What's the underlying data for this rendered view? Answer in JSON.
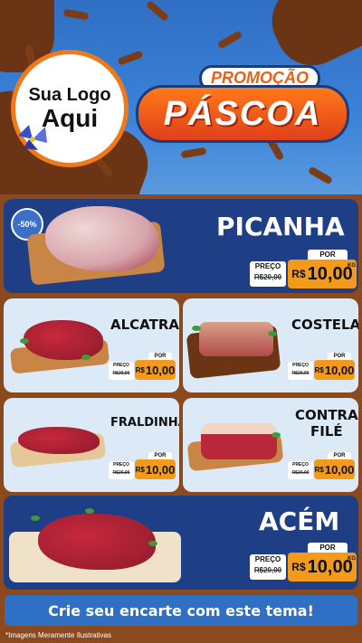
{
  "header": {
    "logo_line1": "Sua Logo",
    "logo_line2": "Aqui",
    "promo_line1": "PROMOÇÃO",
    "promo_line2": "PÁSCOA"
  },
  "products": [
    {
      "name": "PICANHA",
      "discount": "-50%",
      "price_label": "PREÇO",
      "old_price": "R$20,00",
      "new_label": "POR",
      "currency": "R$",
      "new_price": "10,00",
      "unit": "KG"
    },
    {
      "name": "ALCATRA",
      "price_label": "PREÇO",
      "old_price": "R$20,00",
      "new_label": "POR",
      "currency": "R$",
      "new_price": "10,00"
    },
    {
      "name": "COSTELA",
      "price_label": "PREÇO",
      "old_price": "R$20,00",
      "new_label": "POR",
      "currency": "R$",
      "new_price": "10,00"
    },
    {
      "name": "FRALDINHA",
      "price_label": "PREÇO",
      "old_price": "R$20,00",
      "new_label": "POR",
      "currency": "R$",
      "new_price": "10,00"
    },
    {
      "name_line1": "CONTRA",
      "name_line2": "FILÉ",
      "price_label": "PREÇO",
      "old_price": "R$20,00",
      "new_label": "POR",
      "currency": "R$",
      "new_price": "10,00"
    },
    {
      "name": "ACÉM",
      "price_label": "PREÇO",
      "old_price": "R$20,00",
      "new_label": "POR",
      "currency": "R$",
      "new_price": "10,00",
      "unit": "KG"
    }
  ],
  "cta_label": "Crie seu encarte com este tema!",
  "footer_note": "*Imagens Meramente Ilustrativas",
  "colors": {
    "blue_dark": "#1e3f86",
    "blue": "#2f6fc4",
    "orange": "#f39a1a",
    "chocolate": "#8a4a1e"
  }
}
